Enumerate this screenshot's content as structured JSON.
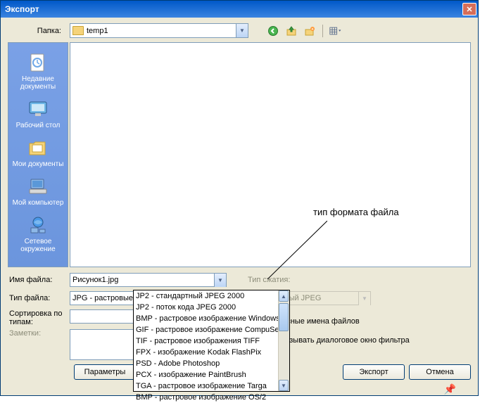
{
  "title": "Экспорт",
  "folder_label": "Папка:",
  "folder_value": "temp1",
  "places": [
    {
      "label": "Недавние документы",
      "icon": "📄"
    },
    {
      "label": "Рабочий стол",
      "icon": "🖥"
    },
    {
      "label": "Мои документы",
      "icon": "📁"
    },
    {
      "label": "Мой компьютер",
      "icon": "💻"
    },
    {
      "label": "Сетевое окружение",
      "icon": "🌐"
    }
  ],
  "filename_label": "Имя файла:",
  "filename_value": "Рисунок1.jpg",
  "filetype_label": "Тип файла:",
  "filetype_value": "JPG - растровые изображения JPEG",
  "sort_label": "Сортировка по типам:",
  "notes_label": "Заметки:",
  "compression_label": "Тип сжатия:",
  "compression_value": "Стандартный JPEG",
  "check1": "Безопасные имена файлов",
  "check2": "Не показывать диалоговое окно фильтра",
  "btn_params": "Параметры",
  "btn_export": "Экспорт",
  "btn_cancel": "Отмена",
  "annotation": "тип формата файла",
  "dropdown_options": [
    "JP2 - стандартный JPEG 2000",
    "JP2 - поток кода JPEG 2000",
    "BMP - растровое изображение Windows",
    "GIF - растровое изображение CompuServe",
    "TIF - растровое изображения TIFF",
    "FPX - изображение Kodak FlashPix",
    "PSD - Adobe Photoshop",
    "PCX - изображение PaintBrush",
    "TGA - растровое изображение Targa",
    "BMP - растровое изображение OS/2"
  ]
}
